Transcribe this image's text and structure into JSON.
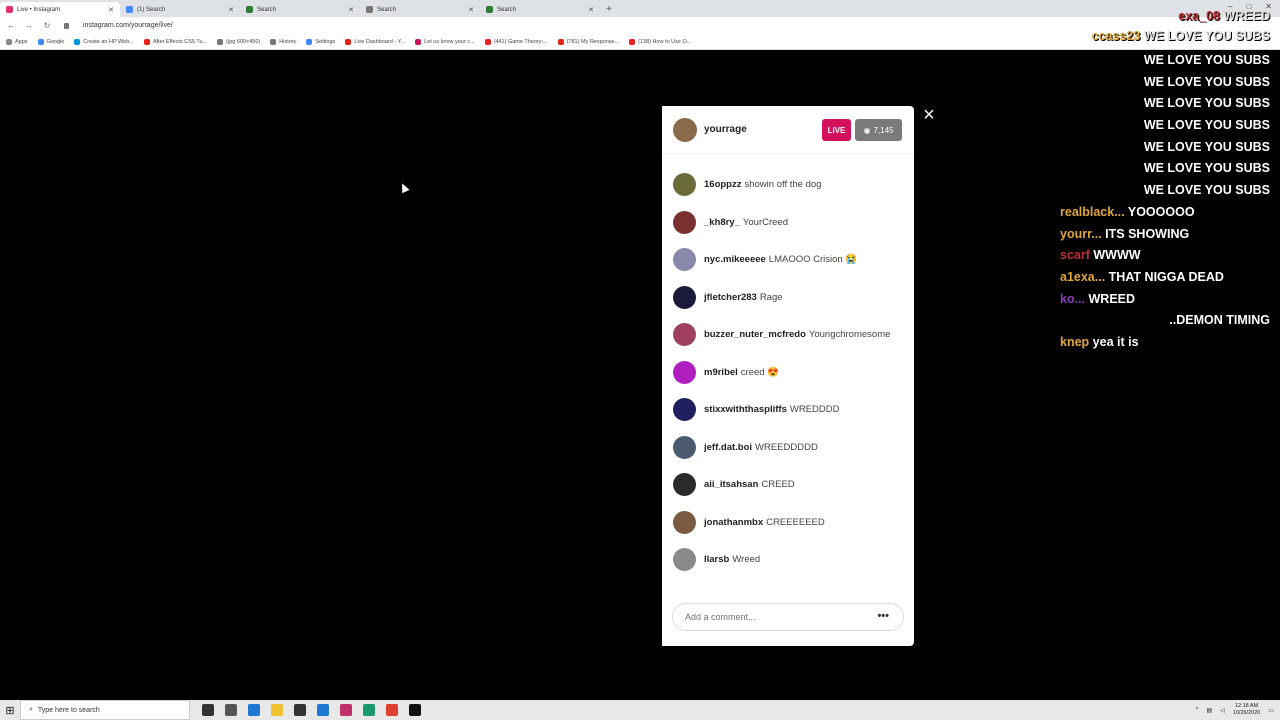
{
  "browser": {
    "tabs": [
      {
        "title": "Live • Instagram",
        "color": "#e1306c",
        "active": true
      },
      {
        "title": "(1) Search",
        "color": "#4285f4",
        "active": false
      },
      {
        "title": "Search",
        "color": "#2e7d32",
        "active": false
      },
      {
        "title": "Search",
        "color": "#777777",
        "active": false
      },
      {
        "title": "Search",
        "color": "#2e7d32",
        "active": false
      }
    ],
    "new_tab": "+",
    "url": "instagram.com/yourrage/live/",
    "bookmarks": [
      {
        "label": "Apps",
        "color": "#888888"
      },
      {
        "label": "Google",
        "color": "#4285f4"
      },
      {
        "label": "Create an HP Web...",
        "color": "#0096d6"
      },
      {
        "label": "After Effects CS5 Tu...",
        "color": "#e62117"
      },
      {
        "label": "(jpg 600×450)",
        "color": "#777777"
      },
      {
        "label": "History",
        "color": "#777777"
      },
      {
        "label": "Settings",
        "color": "#4285f4"
      },
      {
        "label": "Live Dashboard - Y...",
        "color": "#e62117"
      },
      {
        "label": "Let us know your c...",
        "color": "#c2185b"
      },
      {
        "label": "(441) Game Theory:...",
        "color": "#e62117"
      },
      {
        "label": "(781) My Response...",
        "color": "#e62117"
      },
      {
        "label": "(138) How to Use O...",
        "color": "#e62117"
      }
    ]
  },
  "stream_overlay": {
    "chat": [
      {
        "user": "exa_08",
        "message": "WREED",
        "user_color": "red"
      },
      {
        "user": "ccass23",
        "message": "WE LOVE YOU SUBS",
        "user_color": "gold"
      },
      {
        "user": "",
        "message": "WE LOVE YOU SUBS",
        "user_color": "gold"
      },
      {
        "user": "",
        "message": "WE LOVE YOU SUBS",
        "user_color": "gold"
      },
      {
        "user": "",
        "message": "WE LOVE YOU SUBS",
        "user_color": "gold"
      },
      {
        "user": "",
        "message": "WE LOVE YOU SUBS",
        "user_color": "gold"
      },
      {
        "user": "",
        "message": "WE LOVE YOU SUBS",
        "user_color": "gold"
      },
      {
        "user": "",
        "message": "WE LOVE YOU SUBS",
        "user_color": "gold"
      },
      {
        "user": "",
        "message": "WE LOVE YOU SUBS",
        "user_color": "gold"
      },
      {
        "user": "realblack...",
        "message": "YOOOOOO",
        "user_color": "gold"
      },
      {
        "user": "yourr...",
        "message": "ITS SHOWING",
        "user_color": "gold"
      },
      {
        "user": "scarf",
        "message": "WWWW",
        "user_color": "red"
      },
      {
        "user": "a1exa...",
        "message": "THAT NIGGA DEAD",
        "user_color": "gold"
      },
      {
        "user": "ko...",
        "message": "WREED",
        "user_color": "purple"
      },
      {
        "user": "",
        "message": "..DEMON TIMING",
        "user_color": "gold"
      },
      {
        "user": "knep",
        "message": "yea it is",
        "user_color": "gold"
      }
    ]
  },
  "live_modal": {
    "host": {
      "username": "yourrage",
      "avatar_color": "#8a6a4a"
    },
    "live_label": "LIVE",
    "live_color": "#d4105c",
    "viewer_count": "7,145",
    "comments": [
      {
        "user": "16oppzz",
        "text": "showin off the dog",
        "avatar_color": "#6b6b3a"
      },
      {
        "user": "_kh8ry_",
        "text": "YourCreed",
        "avatar_color": "#7a3030"
      },
      {
        "user": "nyc.mikeeeee",
        "text": "LMAOOO Crision 😭",
        "avatar_color": "#8888aa"
      },
      {
        "user": "jfletcher283",
        "text": "Rage",
        "avatar_color": "#1a1a3a"
      },
      {
        "user": "buzzer_nuter_mcfredo",
        "text": "Youngchromesome",
        "avatar_color": "#a04060"
      },
      {
        "user": "m9ribel",
        "text": "creed 😍",
        "avatar_color": "#b020c0"
      },
      {
        "user": "stixxwiththaspliffs",
        "text": "WREDDDD",
        "avatar_color": "#202060"
      },
      {
        "user": "jeff.dat.boi",
        "text": "WREEDDDDD",
        "avatar_color": "#4a5a70"
      },
      {
        "user": "aii_itsahsan",
        "text": "CREED",
        "avatar_color": "#2a2a2a"
      },
      {
        "user": "jonathanmbx",
        "text": "CREEEEEED",
        "avatar_color": "#7a5a40"
      },
      {
        "user": "llarsb",
        "text": "Wreed",
        "avatar_color": "#8a8a8a"
      }
    ],
    "comment_placeholder": "Add a comment...",
    "more_label": "•••",
    "close_label": "×"
  },
  "taskbar": {
    "search_placeholder": "Type here to search",
    "time": "12:18 AM",
    "date": "10/26/2020",
    "icons": [
      {
        "name": "cortana-icon",
        "color": "#333333"
      },
      {
        "name": "task-view-icon",
        "color": "#555555"
      },
      {
        "name": "edge-icon",
        "color": "#1e78d2"
      },
      {
        "name": "file-explorer-icon",
        "color": "#f0c030"
      },
      {
        "name": "store-icon",
        "color": "#333333"
      },
      {
        "name": "mail-icon",
        "color": "#1e78d2"
      },
      {
        "name": "snip-icon",
        "color": "#c0306a"
      },
      {
        "name": "app-green-icon",
        "color": "#1a9a6a"
      },
      {
        "name": "chrome-icon",
        "color": "#e04030"
      },
      {
        "name": "terminal-icon",
        "color": "#111111"
      }
    ]
  }
}
